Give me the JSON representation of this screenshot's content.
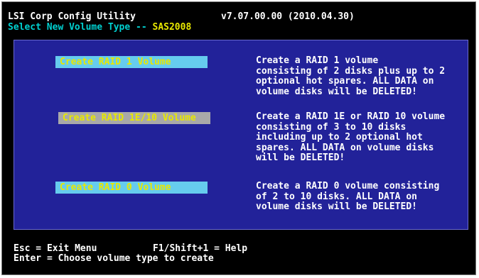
{
  "header": {
    "app_title": "LSI Corp Config Utility",
    "version": "v7.07.00.00 (2010.04.30)",
    "subtitle_prefix": "Select New Volume Type -- ",
    "controller": "SAS2008"
  },
  "options": [
    {
      "label": "Create RAID 1 Volume",
      "description": [
        "Create a RAID 1 volume",
        "consisting of 2 disks plus up to 2",
        "optional hot spares. ALL DATA on",
        "volume disks will be DELETED!"
      ]
    },
    {
      "label": "Create RAID 1E/10 Volume",
      "description": [
        "Create a RAID 1E or RAID 10 volume",
        "consisting of 3 to 10 disks",
        "including up to 2 optional hot",
        "spares. ALL DATA on volume disks",
        "will be DELETED!"
      ]
    },
    {
      "label": "Create RAID 0 Volume",
      "description": [
        "Create a RAID 0 volume consisting",
        "of 2 to 10 disks. ALL DATA on",
        "volume disks will be DELETED!"
      ]
    }
  ],
  "footer": {
    "esc": "Esc = Exit Menu",
    "help": "F1/Shift+1 = Help",
    "enter": "Enter = Choose volume type to create"
  },
  "colors": {
    "panel_background": "#222299",
    "option_highlight": "#66ccee",
    "option_selected": "#a9a9a9",
    "option_text": "#e8e800",
    "subtitle_text": "#00d0d0"
  }
}
